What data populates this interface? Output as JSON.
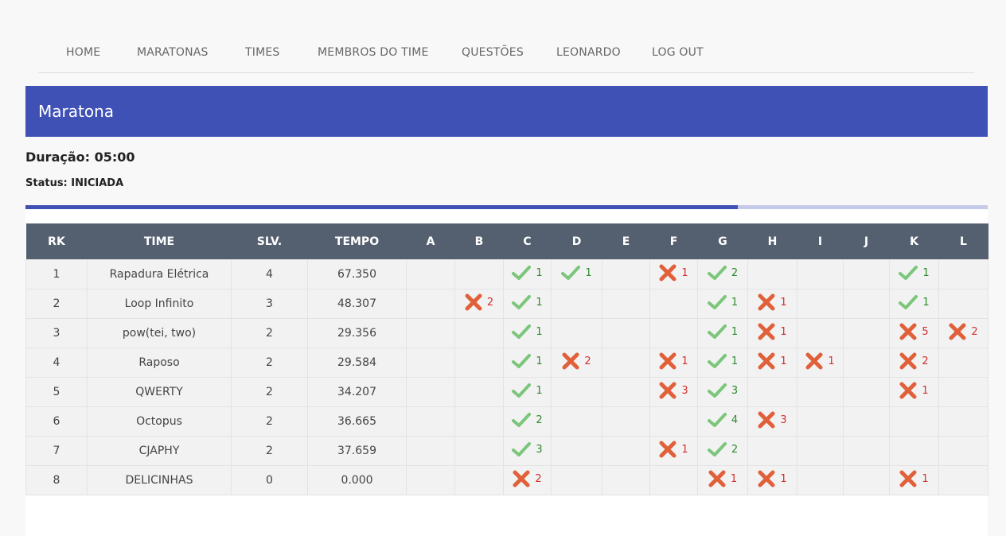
{
  "nav": {
    "items": [
      "HOME",
      "MARATONAS",
      "TIMES",
      "MEMBROS DO TIME",
      "QUESTÕES",
      "LEONARDO",
      "LOG OUT"
    ]
  },
  "header": {
    "title": "Maratona"
  },
  "info": {
    "duracao": "Duração: 05:00",
    "status": "Status: INICIADA",
    "progress": 0.74
  },
  "table": {
    "headers": [
      "RK",
      "TIME",
      "SLV.",
      "TEMPO",
      "A",
      "B",
      "C",
      "D",
      "E",
      "F",
      "G",
      "H",
      "I",
      "J",
      "K",
      "L"
    ],
    "problems": [
      "A",
      "B",
      "C",
      "D",
      "E",
      "F",
      "G",
      "H",
      "I",
      "J",
      "K",
      "L"
    ],
    "rows": [
      {
        "rk": "1",
        "team": "Rapadura Elétrica",
        "solved": "4",
        "time": "67.350",
        "results": {
          "C": [
            "ok",
            "1"
          ],
          "D": [
            "ok",
            "1"
          ],
          "F": [
            "err",
            "1"
          ],
          "G": [
            "ok",
            "2"
          ],
          "K": [
            "ok",
            "1"
          ]
        }
      },
      {
        "rk": "2",
        "team": "Loop Infinito",
        "solved": "3",
        "time": "48.307",
        "results": {
          "B": [
            "err",
            "2"
          ],
          "C": [
            "ok",
            "1"
          ],
          "G": [
            "ok",
            "1"
          ],
          "H": [
            "err",
            "1"
          ],
          "K": [
            "ok",
            "1"
          ]
        }
      },
      {
        "rk": "3",
        "team": "pow(tei, two)",
        "solved": "2",
        "time": "29.356",
        "results": {
          "C": [
            "ok",
            "1"
          ],
          "G": [
            "ok",
            "1"
          ],
          "H": [
            "err",
            "1"
          ],
          "K": [
            "err",
            "5"
          ],
          "L": [
            "err",
            "2"
          ]
        }
      },
      {
        "rk": "4",
        "team": "Raposo",
        "solved": "2",
        "time": "29.584",
        "results": {
          "C": [
            "ok",
            "1"
          ],
          "D": [
            "err",
            "2"
          ],
          "F": [
            "err",
            "1"
          ],
          "G": [
            "ok",
            "1"
          ],
          "H": [
            "err",
            "1"
          ],
          "I": [
            "err",
            "1"
          ],
          "K": [
            "err",
            "2"
          ]
        }
      },
      {
        "rk": "5",
        "team": "QWERTY",
        "solved": "2",
        "time": "34.207",
        "results": {
          "C": [
            "ok",
            "1"
          ],
          "F": [
            "err",
            "3"
          ],
          "G": [
            "ok",
            "3"
          ],
          "K": [
            "err",
            "1"
          ]
        }
      },
      {
        "rk": "6",
        "team": "Octopus",
        "solved": "2",
        "time": "36.665",
        "results": {
          "C": [
            "ok",
            "2"
          ],
          "G": [
            "ok",
            "4"
          ],
          "H": [
            "err",
            "3"
          ]
        }
      },
      {
        "rk": "7",
        "team": "CJAPHY",
        "solved": "2",
        "time": "37.659",
        "results": {
          "C": [
            "ok",
            "3"
          ],
          "F": [
            "err",
            "1"
          ],
          "G": [
            "ok",
            "2"
          ]
        }
      },
      {
        "rk": "8",
        "team": "DELICINHAS",
        "solved": "0",
        "time": "0.000",
        "results": {
          "C": [
            "err",
            "2"
          ],
          "G": [
            "err",
            "1"
          ],
          "H": [
            "err",
            "1"
          ],
          "K": [
            "err",
            "1"
          ]
        }
      }
    ]
  },
  "icons": {
    "ok": "check-icon",
    "err": "cross-icon"
  },
  "colors": {
    "accent": "#3f51b5",
    "header_dark": "#546070",
    "ok": "#7bc67b",
    "err": "#e0603a"
  }
}
